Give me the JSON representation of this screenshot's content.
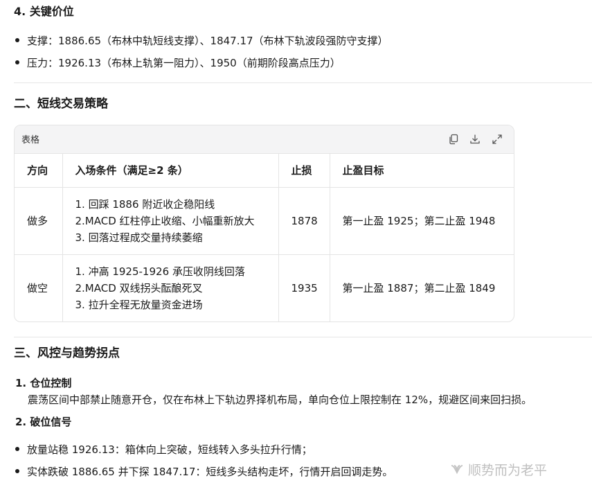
{
  "section4": {
    "heading": "4. 关键价位",
    "items": [
      "支撑：1886.65（布林中轨短线支撑）、1847.17（布林下轨波段强防守支撑）",
      "压力：1926.13（布林上轨第一阻力）、1950（前期阶段高点压力）"
    ]
  },
  "section2": {
    "heading": "二、短线交易策略",
    "table": {
      "label": "表格",
      "tools": [
        "copy-icon",
        "download-icon",
        "expand-icon"
      ],
      "columns": [
        "方向",
        "入场条件（满足≥2 条）",
        "止损",
        "止盈目标"
      ],
      "rows": [
        {
          "direction": "做多",
          "conditions": [
            "1. 回踩 1886 附近收企稳阳线",
            "2.MACD 红柱停止收缩、小幅重新放大",
            "3. 回落过程成交量持续萎缩"
          ],
          "stop": "1878",
          "target": "第一止盈 1925；第二止盈 1948"
        },
        {
          "direction": "做空",
          "conditions": [
            "1. 冲高 1925-1926 承压收阴线回落",
            "2.MACD 双线拐头酝酿死叉",
            "3. 拉升全程无放量资金进场"
          ],
          "stop": "1935",
          "target": "第一止盈 1887；第二止盈 1849"
        }
      ]
    }
  },
  "section3": {
    "heading": "三、风控与趋势拐点",
    "list": [
      {
        "title": "1. 仓位控制",
        "body": "震荡区间中部禁止随意开仓，仅在布林上下轨边界择机布局，单向仓位上限控制在 12%，规避区间来回扫损。"
      },
      {
        "title": "2. 破位信号",
        "body": ""
      }
    ],
    "bullets": [
      "放量站稳 1926.13：箱体向上突破，短线转入多头拉升行情；",
      "实体跌破 1886.65 并下探 1847.17：短线多头结构走坏，行情开启回调走势。"
    ]
  },
  "watermark": {
    "text": "顺势而为老平",
    "icon": "wechat-channels-icon"
  }
}
